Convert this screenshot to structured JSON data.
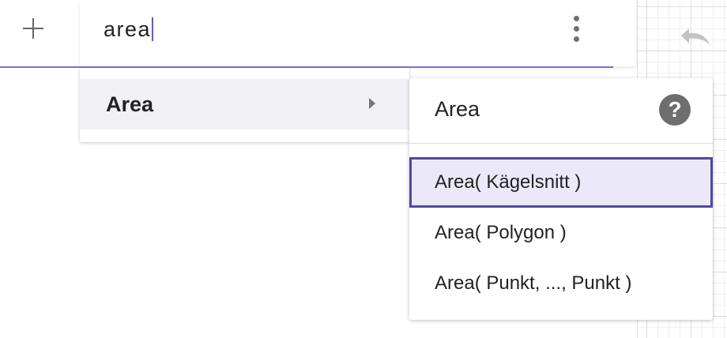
{
  "algebra": {
    "add_icon": "plus-icon",
    "input_value": "area",
    "menu_icon": "more-vertical-icon"
  },
  "suggestions": {
    "items": [
      {
        "label": "Area",
        "arrow_icon": "triangle-right-icon",
        "highlighted": true
      }
    ]
  },
  "syntax_menu": {
    "title": "Area",
    "help_icon": "question-mark-icon",
    "help_glyph": "?",
    "options": [
      {
        "label": "Area( Kägelsnitt )",
        "selected": true
      },
      {
        "label": "Area( Polygon )",
        "selected": false
      },
      {
        "label": "Area( Punkt, ..., Punkt )",
        "selected": false
      }
    ]
  },
  "graphics": {
    "undo_icon": "undo-icon"
  },
  "colors": {
    "accent": "#6557d2",
    "selection_border": "#4e47a8",
    "selection_fill": "#ebe9f8",
    "hover_fill": "#f0f0f5",
    "icon_gray": "#6e6e6e"
  }
}
